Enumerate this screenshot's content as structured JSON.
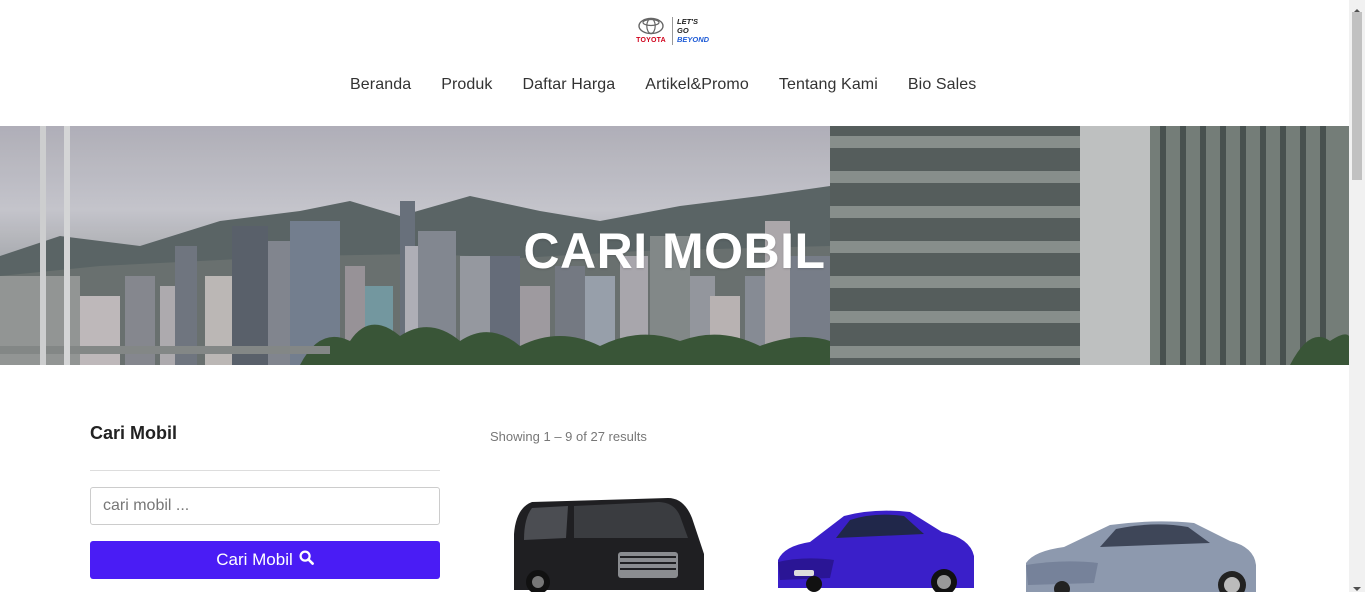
{
  "header": {
    "logo": {
      "brand": "TOYOTA",
      "tagline_1": "LET'S",
      "tagline_2": "GO",
      "tagline_3": "BEYOND"
    },
    "nav": [
      {
        "label": "Beranda"
      },
      {
        "label": "Produk"
      },
      {
        "label": "Daftar Harga"
      },
      {
        "label": "Artikel&Promo"
      },
      {
        "label": "Tentang Kami"
      },
      {
        "label": "Bio Sales"
      }
    ]
  },
  "hero": {
    "title": "CARI MOBIL"
  },
  "sidebar": {
    "title": "Cari Mobil",
    "search_placeholder": "cari mobil ...",
    "search_button_label": "Cari Mobil",
    "search_button_icon": "search-icon"
  },
  "results": {
    "count_text": "Showing 1 – 9 of 27 results",
    "products": [
      {
        "color": "#1f1f22",
        "icon": "minivan-black"
      },
      {
        "color": "#3a1fc9",
        "icon": "sedan-blue"
      },
      {
        "color": "#8d99ae",
        "icon": "sedan-silver"
      }
    ]
  },
  "colors": {
    "accent": "#4a1cf5",
    "text": "#333333"
  }
}
